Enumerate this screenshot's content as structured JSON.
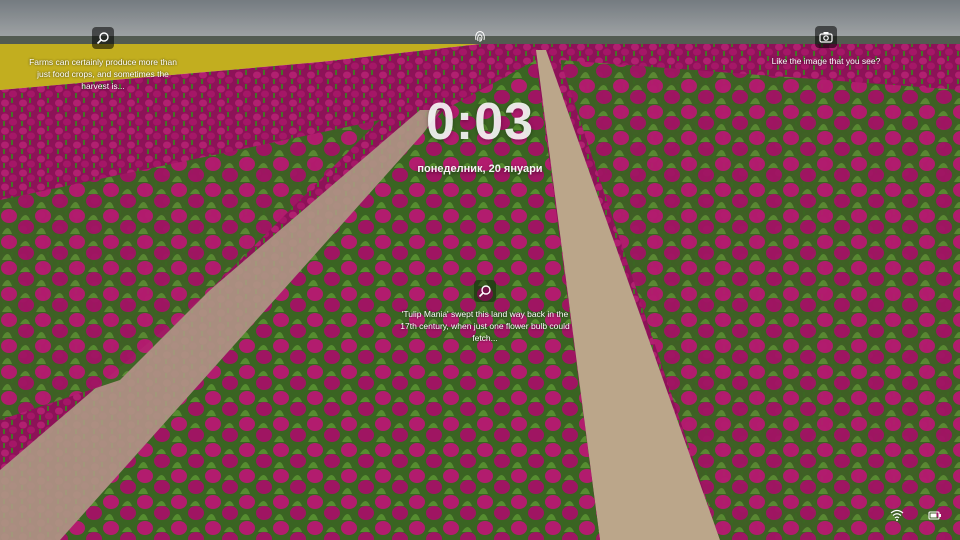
{
  "lock_screen": {
    "time": "0:03",
    "date": "понеделник, 20 януари"
  },
  "spotlight": {
    "hotspot_top_left": "Farms can certainly produce more than just food crops, and sometimes the harvest is...",
    "hotspot_center": "'Tulip Mania' swept this land way back in the 17th century, when just one flower bulb could fetch...",
    "like_prompt": "Like the image that you see?"
  },
  "icons": {
    "search": "search-icon",
    "camera": "camera-icon",
    "fingerprint": "fingerprint-icon",
    "network": "wifi-icon",
    "battery": "battery-icon"
  },
  "colors": {
    "tulip": "#b0106a",
    "field_yellow": "#d9c21a",
    "sky": "#8d949a",
    "path": "#cdb89c"
  }
}
